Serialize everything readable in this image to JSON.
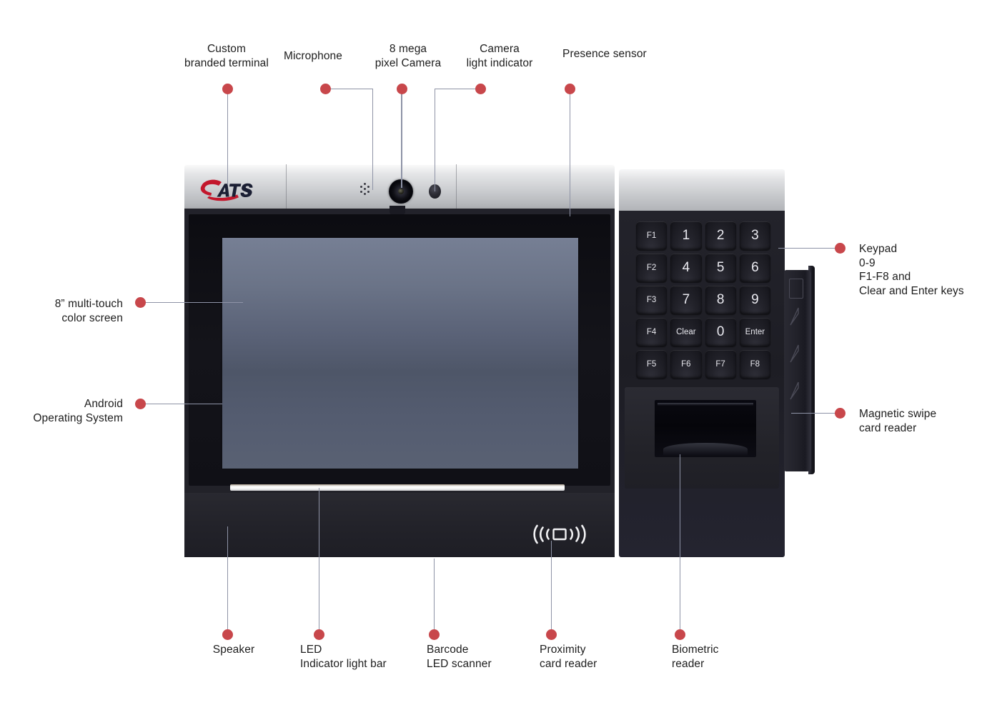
{
  "diagram": {
    "title": "ATS custom branded terminal — feature callouts",
    "accent_color": "#c8474b",
    "leader_color": "#8e93a6",
    "text_color": "#1d1d1d",
    "background": "#ffffff"
  },
  "device": {
    "brand": "ATS",
    "screen_color_top": "#767f94",
    "screen_color_bottom": "#596173",
    "bezel_color": "#c9cbce",
    "body_color": "#22222a"
  },
  "callouts": {
    "custom_branded_terminal": "Custom\nbranded terminal",
    "microphone": "Microphone",
    "camera": "8 mega\npixel Camera",
    "camera_light_indicator": "Camera\nlight indicator",
    "presence_sensor": "Presence sensor",
    "screen": "8” multi-touch\ncolor screen",
    "android": "Android\nOperating System",
    "keypad": "Keypad\n0-9\nF1-F8 and\nClear and Enter keys",
    "magnetic_swipe": "Magnetic swipe\ncard reader",
    "speaker": "Speaker",
    "led_bar": "LED\nIndicator light bar",
    "barcode": "Barcode\nLED scanner",
    "proximity": "Proximity\ncard reader",
    "biometric": "Biometric\nreader"
  },
  "keypad": {
    "rows": [
      [
        {
          "label": "F1",
          "kind": "fn"
        },
        {
          "label": "1",
          "kind": "num"
        },
        {
          "label": "2",
          "kind": "num"
        },
        {
          "label": "3",
          "kind": "num"
        }
      ],
      [
        {
          "label": "F2",
          "kind": "fn"
        },
        {
          "label": "4",
          "kind": "num"
        },
        {
          "label": "5",
          "kind": "num"
        },
        {
          "label": "6",
          "kind": "num"
        }
      ],
      [
        {
          "label": "F3",
          "kind": "fn"
        },
        {
          "label": "7",
          "kind": "num"
        },
        {
          "label": "8",
          "kind": "num"
        },
        {
          "label": "9",
          "kind": "num"
        }
      ],
      [
        {
          "label": "F4",
          "kind": "fn"
        },
        {
          "label": "Clear",
          "kind": "wd"
        },
        {
          "label": "0",
          "kind": "num"
        },
        {
          "label": "Enter",
          "kind": "wd"
        }
      ],
      [
        {
          "label": "F5",
          "kind": "fn"
        },
        {
          "label": "F6",
          "kind": "fn"
        },
        {
          "label": "F7",
          "kind": "fn"
        },
        {
          "label": "F8",
          "kind": "fn"
        }
      ]
    ]
  },
  "icons": {
    "microphone": "microphone-grille-icon",
    "camera": "camera-lens-icon",
    "camera_light": "camera-light-indicator-icon",
    "proximity": "nfc-contactless-icon",
    "logo": "ats-logo"
  }
}
